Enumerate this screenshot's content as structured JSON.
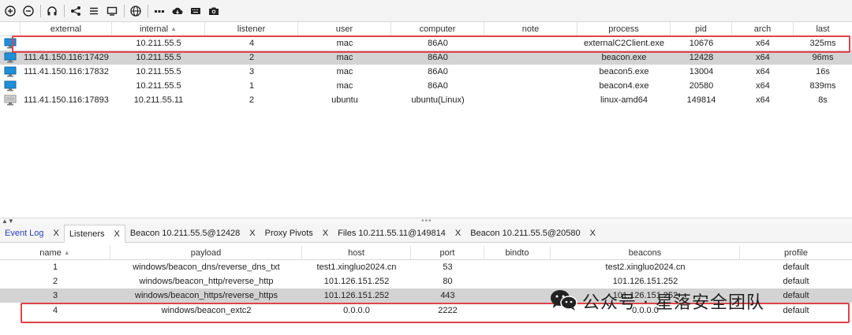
{
  "toolbar": {
    "icons": [
      "plus-circle-icon",
      "minus-circle-icon",
      "headphones-icon",
      "share-icon",
      "list-icon",
      "monitor-icon",
      "globe-icon",
      "dots-icon",
      "cloud-download-icon",
      "keyboard-icon",
      "camera-icon"
    ]
  },
  "beacons": {
    "columns": [
      "external",
      "internal",
      "listener",
      "user",
      "computer",
      "note",
      "process",
      "pid",
      "arch",
      "last"
    ],
    "rows": [
      {
        "external": "",
        "internal": "10.211.55.5",
        "listener": "4",
        "user": "mac",
        "computer": "86A0",
        "note": "",
        "process": "externalC2Client.exe",
        "pid": "10676",
        "arch": "x64",
        "last": "325ms",
        "icon": "windows-beacon-icon"
      },
      {
        "external": "111.41.150.116:17429",
        "internal": "10.211.55.5",
        "listener": "2",
        "user": "mac",
        "computer": "86A0",
        "note": "",
        "process": "beacon.exe",
        "pid": "12428",
        "arch": "x64",
        "last": "96ms",
        "icon": "windows-beacon-icon"
      },
      {
        "external": "111.41.150.116:17832",
        "internal": "10.211.55.5",
        "listener": "3",
        "user": "mac",
        "computer": "86A0",
        "note": "",
        "process": "beacon5.exe",
        "pid": "13004",
        "arch": "x64",
        "last": "16s",
        "icon": "windows-beacon-icon"
      },
      {
        "external": "",
        "internal": "10.211.55.5",
        "listener": "1",
        "user": "mac",
        "computer": "86A0",
        "note": "",
        "process": "beacon4.exe",
        "pid": "20580",
        "arch": "x64",
        "last": "839ms",
        "icon": "windows-beacon-icon"
      },
      {
        "external": "111.41.150.116:17893",
        "internal": "10.211.55.11",
        "listener": "2",
        "user": "ubuntu",
        "computer": "ubuntu(Linux)",
        "note": "",
        "process": "linux-amd64",
        "pid": "149814",
        "arch": "x64",
        "last": "8s",
        "icon": "linux-beacon-icon"
      }
    ]
  },
  "tabs": [
    {
      "label": "Event Log",
      "close": "X"
    },
    {
      "label": "Listeners",
      "close": "X"
    },
    {
      "label": "Beacon 10.211.55.5@12428",
      "close": "X"
    },
    {
      "label": "Proxy Pivots",
      "close": "X"
    },
    {
      "label": "Files 10.211.55.11@149814",
      "close": "X"
    },
    {
      "label": "Beacon 10.211.55.5@20580",
      "close": "X"
    }
  ],
  "listeners": {
    "columns": [
      "name",
      "payload",
      "host",
      "port",
      "bindto",
      "beacons",
      "profile"
    ],
    "rows": [
      {
        "name": "1",
        "payload": "windows/beacon_dns/reverse_dns_txt",
        "host": "test1.xingluo2024.cn",
        "port": "53",
        "bindto": "",
        "beacons": "test2.xingluo2024.cn",
        "profile": "default"
      },
      {
        "name": "2",
        "payload": "windows/beacon_http/reverse_http",
        "host": "101.126.151.252",
        "port": "80",
        "bindto": "",
        "beacons": "101.126.151.252",
        "profile": "default"
      },
      {
        "name": "3",
        "payload": "windows/beacon_https/reverse_https",
        "host": "101.126.151.252",
        "port": "443",
        "bindto": "",
        "beacons": "101.126.151.252",
        "profile": "default"
      },
      {
        "name": "4",
        "payload": "windows/beacon_extc2",
        "host": "0.0.0.0",
        "port": "2222",
        "bindto": "",
        "beacons": "0.0.0.0",
        "profile": "default"
      }
    ]
  },
  "watermark": {
    "text": "公众号 · 星落安全团队"
  },
  "colors": {
    "highlight": "#e0434a",
    "selected_row": "#d3d3d3",
    "tab_link": "#2a43b5",
    "windows_icon": "#1f8fd8"
  }
}
